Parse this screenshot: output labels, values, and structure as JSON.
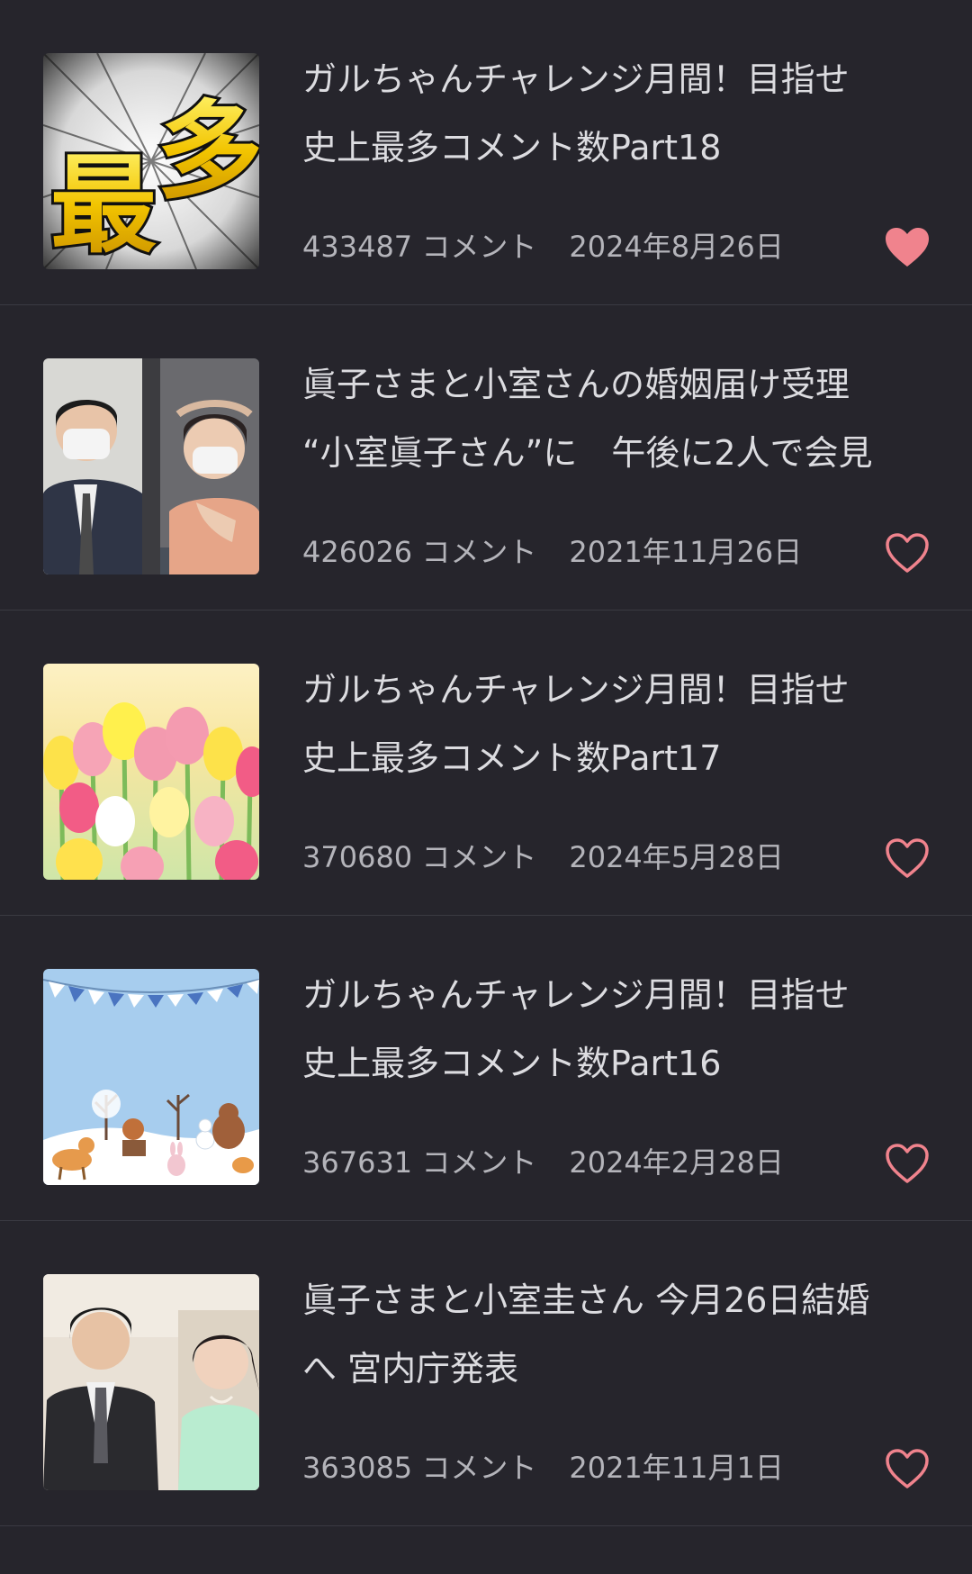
{
  "colors": {
    "background": "#26252c",
    "divider": "#3a3a42",
    "title_text": "#dcdce0",
    "meta_text": "#b4b4ba",
    "heart": "#f0838d"
  },
  "topics": [
    {
      "title": "ガルちゃんチャレンジ月間！目指せ\n史上最多コメント数Part18",
      "comments": "433487 コメント",
      "date": "2024年8月26日",
      "favorited": true,
      "thumbnail_icon": "saita-text-thumbnail",
      "thumbnail_text": "最多"
    },
    {
      "title": "眞子さまと小室さんの婚姻届け受理\n“小室眞子さん”に　午後に2人で会見",
      "comments": "426026 コメント",
      "date": "2021年11月26日",
      "favorited": false,
      "thumbnail_icon": "news-photo-thumbnail"
    },
    {
      "title": "ガルちゃんチャレンジ月間！目指せ\n史上最多コメント数Part17",
      "comments": "370680 コメント",
      "date": "2024年5月28日",
      "favorited": false,
      "thumbnail_icon": "tulip-field-thumbnail"
    },
    {
      "title": "ガルちゃんチャレンジ月間！目指せ\n史上最多コメント数Part16",
      "comments": "367631 コメント",
      "date": "2024年2月28日",
      "favorited": false,
      "thumbnail_icon": "winter-animals-thumbnail"
    },
    {
      "title": "眞子さまと小室圭さん 今月26日結婚\nへ 宮内庁発表",
      "comments": "363085 コメント",
      "date": "2021年11月1日",
      "favorited": false,
      "thumbnail_icon": "news-photo-thumbnail"
    }
  ]
}
